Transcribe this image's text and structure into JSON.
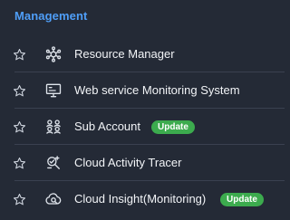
{
  "section": {
    "title": "Management"
  },
  "items": [
    {
      "label": "Resource Manager",
      "icon": "resource-manager-icon",
      "favorite_icon": "star-icon"
    },
    {
      "label": "Web service Monitoring System",
      "icon": "monitor-icon",
      "favorite_icon": "star-icon"
    },
    {
      "label": "Sub Account",
      "icon": "users-icon",
      "favorite_icon": "star-icon",
      "badge": "Update"
    },
    {
      "label": "Cloud Activity Tracer",
      "icon": "activity-tracer-icon",
      "favorite_icon": "star-icon"
    },
    {
      "label": "Cloud Insight(Monitoring)",
      "icon": "cloud-insight-icon",
      "favorite_icon": "star-icon",
      "badge": "Update"
    }
  ],
  "colors": {
    "background": "#242a36",
    "section_title": "#4f9ef8",
    "text": "#f2f4f7",
    "divider": "#3a4150",
    "badge": "#3cab4e"
  }
}
